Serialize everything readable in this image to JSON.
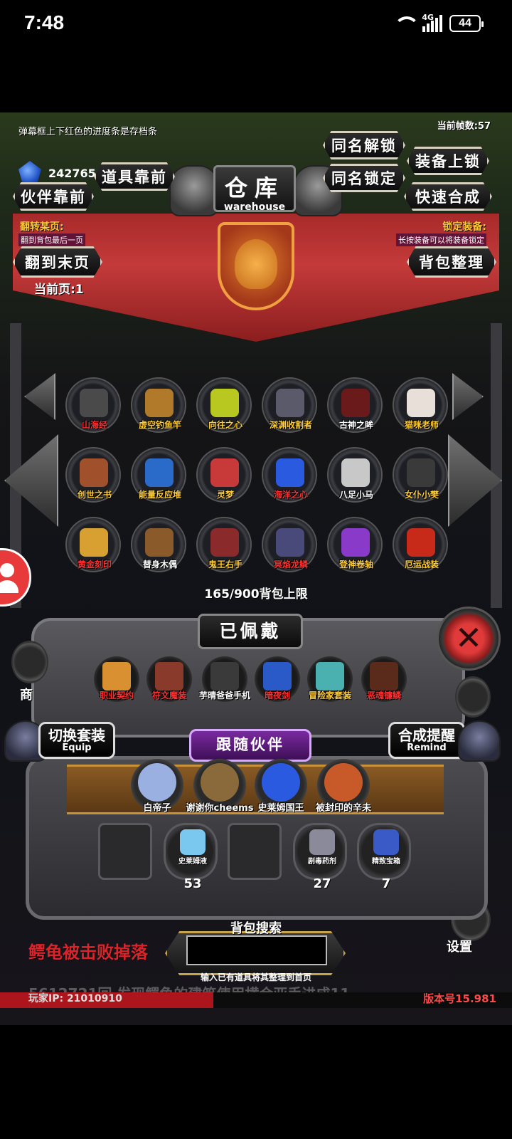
{
  "status_bar": {
    "time": "7:48",
    "network": "4G",
    "battery": "44"
  },
  "header": {
    "save_hint": "弹幕框上下红色的进度条是存档条",
    "fps": "当前帧数:57",
    "currency": "242765",
    "title_cn": "仓库",
    "title_en": "warehouse"
  },
  "buttons": {
    "same_unlock": "同名解锁",
    "equip_lock": "装备上锁",
    "item_front": "道具靠前",
    "same_lock": "同名锁定",
    "partner_front": "伙伴靠前",
    "quick_merge": "快速合成",
    "last_page": "翻到末页",
    "sort_bag": "背包整理"
  },
  "notes": {
    "flip_title": "翻转某页:",
    "flip_sub": "翻到背包最后一页",
    "lock_title": "锁定装备:",
    "lock_sub": "长按装备可以将装备锁定"
  },
  "current_page": "当前页:1",
  "inventory": [
    {
      "name": "山海经",
      "color": "#ff3030",
      "art": "#4a4a4a"
    },
    {
      "name": "虚空钓鱼竿",
      "color": "#ffcc33",
      "art": "#b07a2a"
    },
    {
      "name": "向往之心",
      "color": "#ffcc33",
      "art": "#b8c820"
    },
    {
      "name": "深渊收割者",
      "color": "#ffcc33",
      "art": "#5a5a6a"
    },
    {
      "name": "古神之眸",
      "color": "#ffffff",
      "art": "#6a1a1a"
    },
    {
      "name": "猫咪老师",
      "color": "#ffcc33",
      "art": "#e8e0d8"
    },
    {
      "name": "创世之书",
      "color": "#ffcc33",
      "art": "#a0502a"
    },
    {
      "name": "能量反应堆",
      "color": "#ffcc33",
      "art": "#2a6ac8"
    },
    {
      "name": "灵梦",
      "color": "#ffcc33",
      "art": "#c83a3a"
    },
    {
      "name": "海洋之心",
      "color": "#ff3030",
      "art": "#2a5ae0"
    },
    {
      "name": "八足小马",
      "color": "#ffffff",
      "art": "#c8c8c8"
    },
    {
      "name": "女仆小樊",
      "color": "#ffcc33",
      "art": "#3a3a3a"
    },
    {
      "name": "黄金刻印",
      "color": "#ff3030",
      "art": "#d8a030"
    },
    {
      "name": "替身木偶",
      "color": "#ffffff",
      "art": "#8a5a2a"
    },
    {
      "name": "鬼王右手",
      "color": "#ffcc33",
      "art": "#8a2a2a"
    },
    {
      "name": "冥焰龙鳞",
      "color": "#ff3030",
      "art": "#4a4a7a"
    },
    {
      "name": "登神卷轴",
      "color": "#ffcc33",
      "art": "#8a3ac8"
    },
    {
      "name": "厄运战装",
      "color": "#ffcc33",
      "art": "#c82a1a"
    }
  ],
  "capacity": "165/900背包上限",
  "equipped_title": "已佩戴",
  "equipped": [
    {
      "name": "职业契约",
      "color": "#ff3030",
      "art": "#d89030"
    },
    {
      "name": "符文魔装",
      "color": "#ff3030",
      "art": "#8a3a2a"
    },
    {
      "name": "芋晴爸爸手机",
      "color": "#ffffff",
      "art": "#3a3a3a"
    },
    {
      "name": "暗夜剑",
      "color": "#ff3030",
      "art": "#2a5ac8"
    },
    {
      "name": "冒险家套装",
      "color": "#ffcc33",
      "art": "#4ab0b0"
    },
    {
      "name": "恶魂镰鳞",
      "color": "#ff3030",
      "art": "#5a2a1a"
    }
  ],
  "switch_set": {
    "cn": "切换套装",
    "en": "Equip"
  },
  "merge_remind": {
    "cn": "合成提醒",
    "en": "Remind"
  },
  "follow_title": "跟随伙伴",
  "partners": [
    {
      "name": "白帝子",
      "art": "#9ab0e0"
    },
    {
      "name": "谢谢你cheems",
      "art": "#8a6a3a"
    },
    {
      "name": "史莱姆国王",
      "art": "#2a5ae0"
    },
    {
      "name": "被封印的辛未",
      "art": "#c85a2a"
    }
  ],
  "quick_slots": [
    {
      "name": "",
      "count": "",
      "art": ""
    },
    {
      "name": "史莱姆液",
      "count": "53",
      "art": "#7ac8f0"
    },
    {
      "name": "",
      "count": "",
      "art": ""
    },
    {
      "name": "剧毒药剂",
      "count": "27",
      "art": "#8a8a9a"
    },
    {
      "name": "精致宝箱",
      "count": "7",
      "art": "#3a5ac8"
    }
  ],
  "side": {
    "shop_label": "商",
    "settings_label": "设置"
  },
  "log_line": "鳄龟被击败掉落",
  "log_faded": "5612721回 发现鳄龟的建筑使用横合亚手进成11",
  "search": {
    "title": "背包搜索",
    "value": "",
    "hint": "输入已有道具将其整理到首页"
  },
  "player_ip": "玩家IP: 21010910",
  "version": "版本号15.981"
}
